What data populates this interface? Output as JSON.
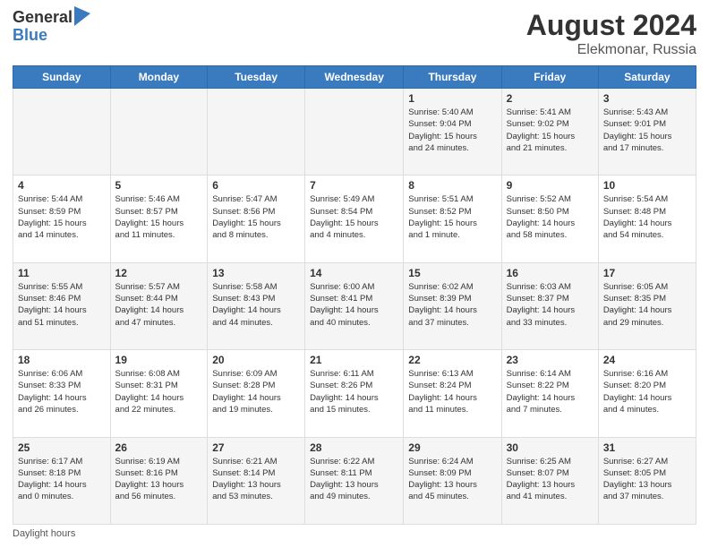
{
  "header": {
    "logo_general": "General",
    "logo_blue": "Blue",
    "month_year": "August 2024",
    "location": "Elekmonar, Russia"
  },
  "days_of_week": [
    "Sunday",
    "Monday",
    "Tuesday",
    "Wednesday",
    "Thursday",
    "Friday",
    "Saturday"
  ],
  "footer": {
    "note": "Daylight hours"
  },
  "weeks": [
    [
      {
        "num": "",
        "info": ""
      },
      {
        "num": "",
        "info": ""
      },
      {
        "num": "",
        "info": ""
      },
      {
        "num": "",
        "info": ""
      },
      {
        "num": "1",
        "info": "Sunrise: 5:40 AM\nSunset: 9:04 PM\nDaylight: 15 hours\nand 24 minutes."
      },
      {
        "num": "2",
        "info": "Sunrise: 5:41 AM\nSunset: 9:02 PM\nDaylight: 15 hours\nand 21 minutes."
      },
      {
        "num": "3",
        "info": "Sunrise: 5:43 AM\nSunset: 9:01 PM\nDaylight: 15 hours\nand 17 minutes."
      }
    ],
    [
      {
        "num": "4",
        "info": "Sunrise: 5:44 AM\nSunset: 8:59 PM\nDaylight: 15 hours\nand 14 minutes."
      },
      {
        "num": "5",
        "info": "Sunrise: 5:46 AM\nSunset: 8:57 PM\nDaylight: 15 hours\nand 11 minutes."
      },
      {
        "num": "6",
        "info": "Sunrise: 5:47 AM\nSunset: 8:56 PM\nDaylight: 15 hours\nand 8 minutes."
      },
      {
        "num": "7",
        "info": "Sunrise: 5:49 AM\nSunset: 8:54 PM\nDaylight: 15 hours\nand 4 minutes."
      },
      {
        "num": "8",
        "info": "Sunrise: 5:51 AM\nSunset: 8:52 PM\nDaylight: 15 hours\nand 1 minute."
      },
      {
        "num": "9",
        "info": "Sunrise: 5:52 AM\nSunset: 8:50 PM\nDaylight: 14 hours\nand 58 minutes."
      },
      {
        "num": "10",
        "info": "Sunrise: 5:54 AM\nSunset: 8:48 PM\nDaylight: 14 hours\nand 54 minutes."
      }
    ],
    [
      {
        "num": "11",
        "info": "Sunrise: 5:55 AM\nSunset: 8:46 PM\nDaylight: 14 hours\nand 51 minutes."
      },
      {
        "num": "12",
        "info": "Sunrise: 5:57 AM\nSunset: 8:44 PM\nDaylight: 14 hours\nand 47 minutes."
      },
      {
        "num": "13",
        "info": "Sunrise: 5:58 AM\nSunset: 8:43 PM\nDaylight: 14 hours\nand 44 minutes."
      },
      {
        "num": "14",
        "info": "Sunrise: 6:00 AM\nSunset: 8:41 PM\nDaylight: 14 hours\nand 40 minutes."
      },
      {
        "num": "15",
        "info": "Sunrise: 6:02 AM\nSunset: 8:39 PM\nDaylight: 14 hours\nand 37 minutes."
      },
      {
        "num": "16",
        "info": "Sunrise: 6:03 AM\nSunset: 8:37 PM\nDaylight: 14 hours\nand 33 minutes."
      },
      {
        "num": "17",
        "info": "Sunrise: 6:05 AM\nSunset: 8:35 PM\nDaylight: 14 hours\nand 29 minutes."
      }
    ],
    [
      {
        "num": "18",
        "info": "Sunrise: 6:06 AM\nSunset: 8:33 PM\nDaylight: 14 hours\nand 26 minutes."
      },
      {
        "num": "19",
        "info": "Sunrise: 6:08 AM\nSunset: 8:31 PM\nDaylight: 14 hours\nand 22 minutes."
      },
      {
        "num": "20",
        "info": "Sunrise: 6:09 AM\nSunset: 8:28 PM\nDaylight: 14 hours\nand 19 minutes."
      },
      {
        "num": "21",
        "info": "Sunrise: 6:11 AM\nSunset: 8:26 PM\nDaylight: 14 hours\nand 15 minutes."
      },
      {
        "num": "22",
        "info": "Sunrise: 6:13 AM\nSunset: 8:24 PM\nDaylight: 14 hours\nand 11 minutes."
      },
      {
        "num": "23",
        "info": "Sunrise: 6:14 AM\nSunset: 8:22 PM\nDaylight: 14 hours\nand 7 minutes."
      },
      {
        "num": "24",
        "info": "Sunrise: 6:16 AM\nSunset: 8:20 PM\nDaylight: 14 hours\nand 4 minutes."
      }
    ],
    [
      {
        "num": "25",
        "info": "Sunrise: 6:17 AM\nSunset: 8:18 PM\nDaylight: 14 hours\nand 0 minutes."
      },
      {
        "num": "26",
        "info": "Sunrise: 6:19 AM\nSunset: 8:16 PM\nDaylight: 13 hours\nand 56 minutes."
      },
      {
        "num": "27",
        "info": "Sunrise: 6:21 AM\nSunset: 8:14 PM\nDaylight: 13 hours\nand 53 minutes."
      },
      {
        "num": "28",
        "info": "Sunrise: 6:22 AM\nSunset: 8:11 PM\nDaylight: 13 hours\nand 49 minutes."
      },
      {
        "num": "29",
        "info": "Sunrise: 6:24 AM\nSunset: 8:09 PM\nDaylight: 13 hours\nand 45 minutes."
      },
      {
        "num": "30",
        "info": "Sunrise: 6:25 AM\nSunset: 8:07 PM\nDaylight: 13 hours\nand 41 minutes."
      },
      {
        "num": "31",
        "info": "Sunrise: 6:27 AM\nSunset: 8:05 PM\nDaylight: 13 hours\nand 37 minutes."
      }
    ]
  ]
}
